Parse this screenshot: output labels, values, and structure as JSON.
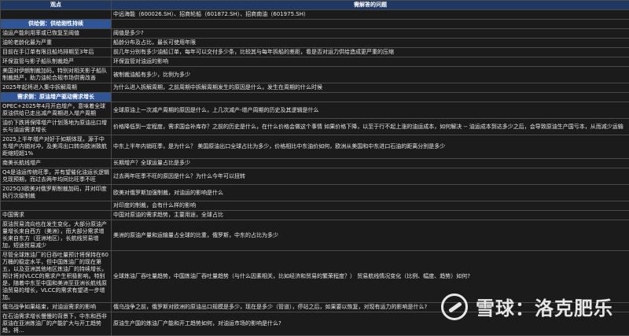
{
  "header": {
    "col1": "观点",
    "col2": "需解答的问题"
  },
  "rows": [
    {
      "left": "",
      "right": "中远海能（600026.SH）、招商轮船（601872.SH）、招商南油（601975.SH）"
    },
    {
      "section": "供给侧：供给刚性持续"
    },
    {
      "left": "油运产能利用率或已恢复至阈值",
      "right": "阈值是多少?"
    },
    {
      "left": "油轮老龄化最为严重",
      "right": "船龄分布及占比，最长可使用年限"
    },
    {
      "left": "目前在手订单有限且船坞排期至3年后",
      "right": "前几年分别有多少油船订单，每年可以交付多少条，比较其与每年拆船的差距，看是否对运力供给造成更严重的压缩"
    },
    {
      "left": "环保监管与影子船队制裁趋严",
      "right": "环保监管对油运的影响"
    },
    {
      "left": "美国对伊朗制裁加码，特别对相关影子船队制裁趋严，助力油轮合规市场供需改善",
      "right": "被制裁油船有多少，比例为多少"
    },
    {
      "left": "2025年起将进入集中拆解周期",
      "right": "为什么进入拆解周期，之前周期中拆解周期发生的原因是什么，发生在周期的什么时候"
    },
    {
      "section": "需求侧：原油增产驱动需求增长"
    },
    {
      "left": "OPEC+2025年4月开启增产，意味着全球原油供给已走出减产周期进入增产周期",
      "right": "全球原油上一次减产周期的原因是什么，上几次减产-增产周期的历史及其逻辑是什么"
    },
    {
      "left": "油价下跌将保障增产计划落地为原油出口增长与油运需求增长",
      "right": "价格降低到一定程度，需求国会补库存？之前的历史是什么，在什么价格会做这个事情 如果价格下降，以至于行不起上涨的油运成本，如何解决 -- 油运成本到达多少之后，会导致原油生产国亏本，从而减少运输"
    },
    {
      "left": "2025上半年增产对好于如期体现，源于中东增产内销对冲，及美湾出口转向欧洲致航距缩短超1%",
      "right": "中东上半年内销旺季，是为什么？ 美国原油出口全球占比为多少，价格相比中东油价如何，欧洲从美国和中东进口石油的距离分别是多少"
    },
    {
      "left": "南美长航线增产",
      "right": "长期增产？全球运量占比是多少"
    },
    {
      "left": "Q4是油运传统旺季，并有望催化油运长逻辑兑现预期，而过去两年均同比旺季不旺",
      "right": "过去两年旺季不旺的原因是什么？为什么今年可以扭转"
    },
    {
      "left": "2025Q3欧美对俄罗斯制裁加码，并对印度执行次级制裁",
      "right": "欧美对俄罗斯加强制裁，对油运的影响是什么"
    },
    {
      "left": "",
      "right": "对印度的制裁，会有什么样的影响"
    },
    {
      "left": "中国需求",
      "right": "中国对原油的需求趋势，主要用途，全球占比"
    },
    {
      "left": "原油贸易流向也在发生变化，大部分原油产量增长来自西方（美洲），而大部分需求增长来自东方（亚洲地区），长航线贸易增加，短途贸易减少",
      "right": "美洲的原油产量和运输量占全球的比重，俄罗斯，中东的占比为多少"
    },
    {
      "left": "尽管全球炼油厂的日吞吐量预计将保持在60万桶的稳定水平，但中国炼油厂的现在第五，以及亚洲其他地区炼油厂的持续增长，预计将对VLCC的需求产生积极影响。特别是，随着中东至中国和美洲至亚洲长航线原油贸易的增长，VLCC的需求有望进一步增加。",
      "right": "全球炼油厂吞吐量趋势，中国炼油厂吞吐量趋势（与什么因素相关，比如经济和贸易的繁荣程度？） 贸易航线情况变化（比例、幅度、趋势）如何?"
    },
    {
      "left": "俄乌战争如果结束，对油运需求的影响",
      "right": "俄乌战争之前，俄罗斯对欧洲的原油出口规模是多少，现在是多少（管道），停站之后，如果要以恢复，对现有运力的影响是什么?"
    },
    {
      "left": "在石油需求增长慢慢的背景下，中东和西非原油在亚洲炼油厂的产能扩大与开工趋势趋，将...",
      "right": "原油生产国的炼油厂产能和开工趋势如何，对油运市场的影响是什么?"
    }
  ],
  "watermark": {
    "brand": "雪球：洛克肥乐"
  }
}
